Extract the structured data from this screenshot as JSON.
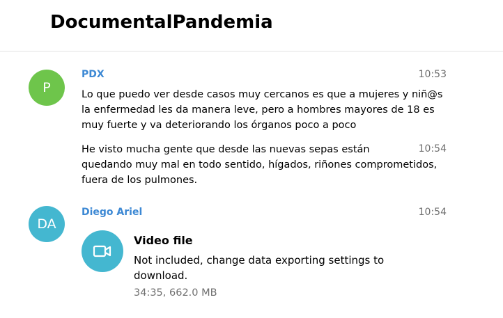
{
  "header": {
    "title": "DocumentalPandemia"
  },
  "messages": [
    {
      "avatar_initials": "P",
      "avatar_color": "#6ec54b",
      "from": "PDX",
      "from_color": "#3c88d4",
      "time": "10:53",
      "text": "Lo que puedo ver desde casos muy cercanos es que a mujeres y niñ@s\nla enfermedad les da manera leve, pero a hombres mayores de 18 es\nmuy fuerte y va deteriorando los órganos poco a poco"
    },
    {
      "time": "10:54",
      "text": "He visto mucha gente que desde las nuevas sepas están\nquedando muy mal en todo sentido, hígados, riñones comprometidos,\nfuera de los pulmones."
    },
    {
      "avatar_initials": "DA",
      "avatar_color": "#44b7d0",
      "from": "Diego Ariel",
      "from_color": "#3c88d4",
      "time": "10:54",
      "attachment": {
        "icon": "video-camera-icon",
        "icon_bg": "#44b7d0",
        "title": "Video file",
        "description": "Not included, change data exporting settings to download.",
        "meta": "34:35, 662.0 MB"
      }
    }
  ]
}
